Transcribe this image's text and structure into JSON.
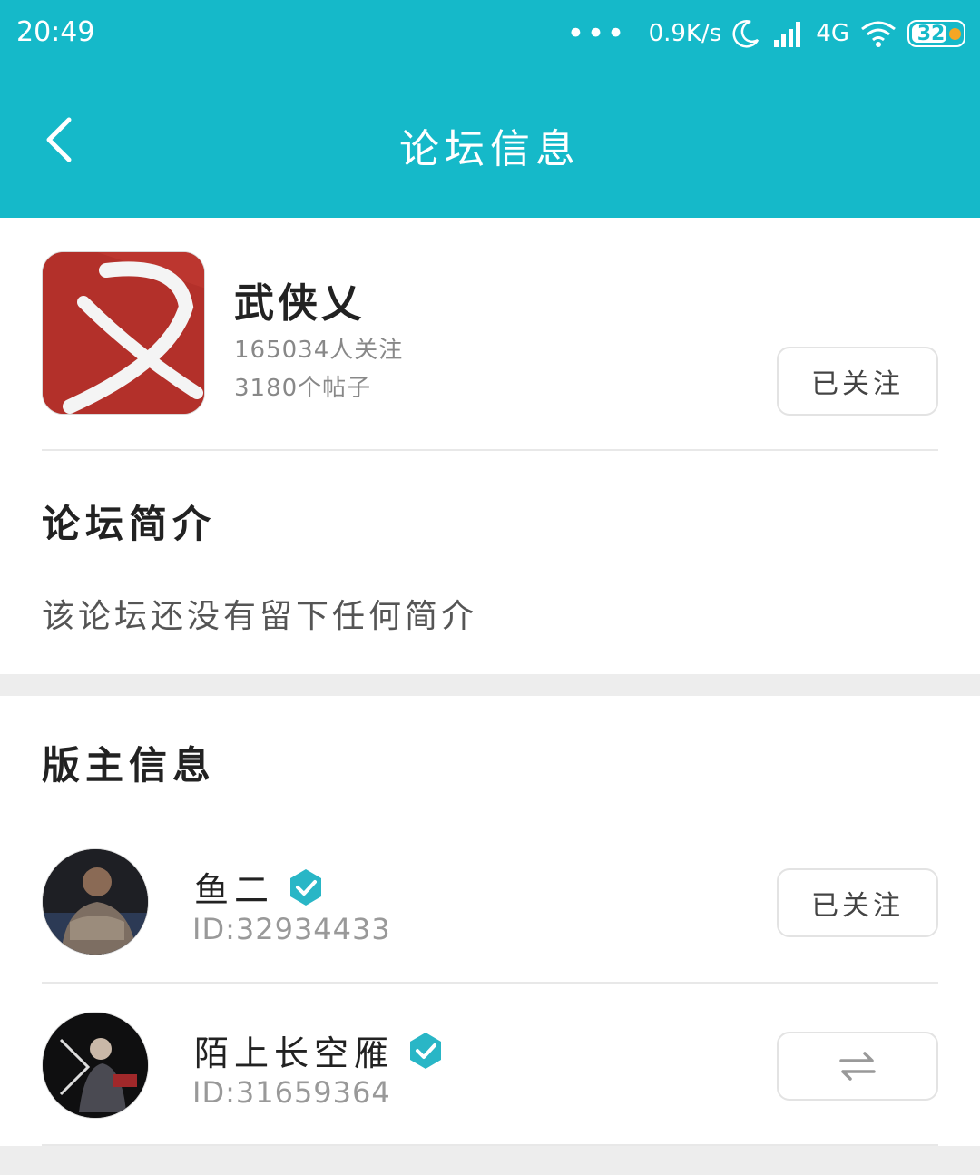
{
  "status_bar": {
    "time": "20:49",
    "more": "•••",
    "net_speed": "0.9K/s",
    "network": "4G",
    "battery": "32"
  },
  "header": {
    "title": "论坛信息"
  },
  "forum": {
    "name": "武侠乂",
    "followers": "165034人关注",
    "posts": "3180个帖子",
    "follow_label": "已关注"
  },
  "intro": {
    "title": "论坛简介",
    "text": "该论坛还没有留下任何简介"
  },
  "moderators": {
    "title": "版主信息",
    "items": [
      {
        "name": "鱼二",
        "id": "ID:32934433",
        "action": "已关注"
      },
      {
        "name": "陌上长空雁",
        "id": "ID:31659364"
      }
    ]
  },
  "colors": {
    "header_bg": "#15b9c9",
    "verified": "#29b6c6",
    "forum_icon_bg": "#b3302a"
  }
}
